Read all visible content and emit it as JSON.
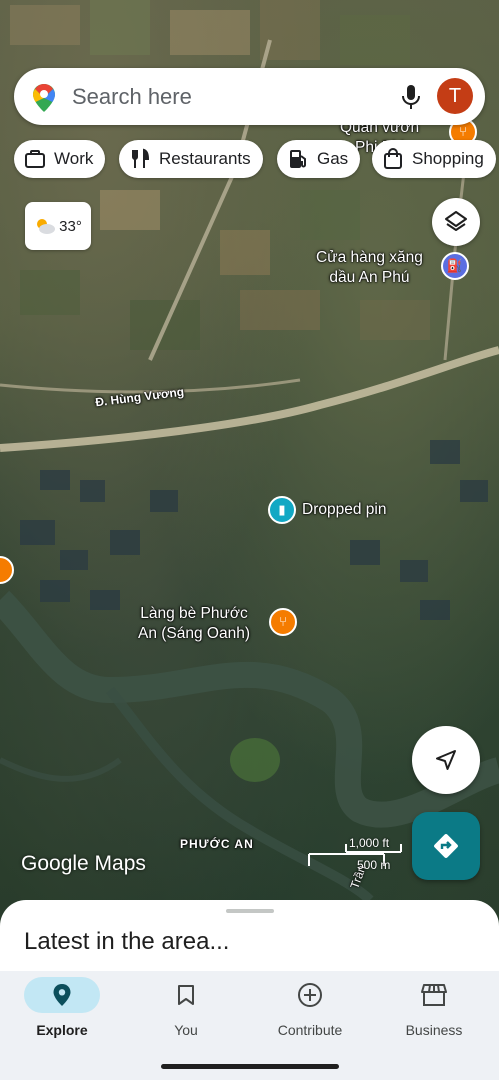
{
  "search": {
    "placeholder": "Search here",
    "avatar_initial": "T"
  },
  "chips": [
    {
      "label": "Work",
      "icon": "briefcase-icon"
    },
    {
      "label": "Restaurants",
      "icon": "fork-knife-icon"
    },
    {
      "label": "Gas",
      "icon": "gas-pump-icon"
    },
    {
      "label": "Shopping",
      "icon": "shopping-bag-icon"
    }
  ],
  "weather": {
    "temperature": "33°",
    "icon": "partly-cloudy-icon"
  },
  "map": {
    "labels": {
      "top_poi": "Quán vườn\nPhi Phi",
      "gas_station": "Cửa hàng xăng\ndầu An Phú",
      "road": "Đ. Hùng Vương",
      "dropped_pin": "Dropped pin",
      "restaurant": "Làng bè Phước\nAn (Sáng Oanh)",
      "area": "PHƯỚC AN",
      "street_bottom": "Trần"
    },
    "scale": {
      "imperial": "1,000 ft",
      "metric": "500 m"
    },
    "brand": "Google Maps",
    "colors": {
      "restaurant_pin": "#f57c00",
      "gas_pin": "#5b6ee1",
      "dropped_pin": "#12a8c4"
    }
  },
  "sheet": {
    "title": "Latest in the area..."
  },
  "nav": [
    {
      "label": "Explore",
      "icon": "location-pin-icon",
      "active": true
    },
    {
      "label": "You",
      "icon": "bookmark-icon",
      "active": false
    },
    {
      "label": "Contribute",
      "icon": "add-circle-icon",
      "active": false
    },
    {
      "label": "Business",
      "icon": "storefront-icon",
      "active": false
    }
  ]
}
